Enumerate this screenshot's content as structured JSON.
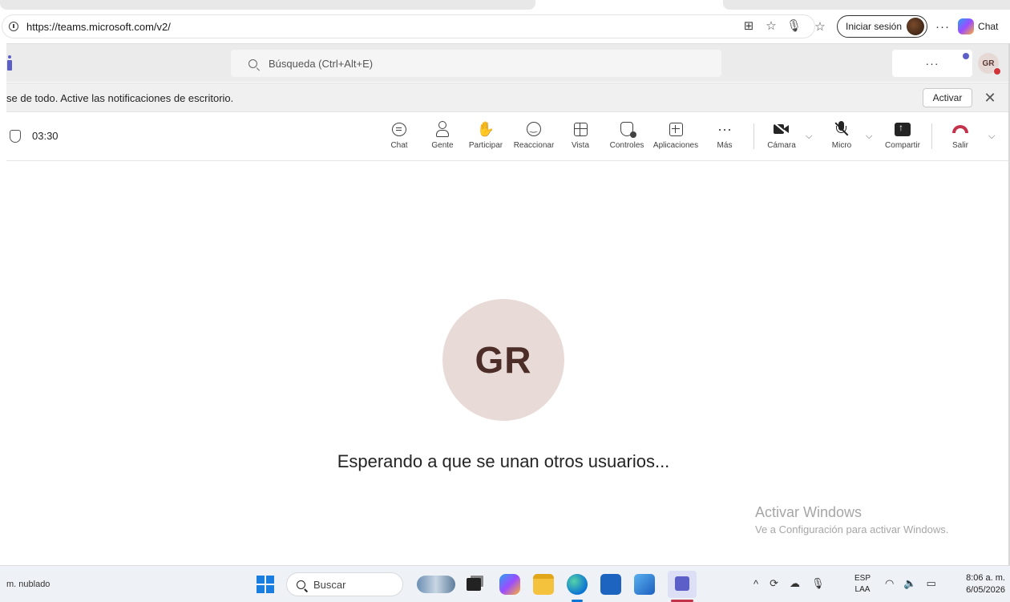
{
  "browser": {
    "url": "https://teams.microsoft.com/v2/",
    "signin_label": "Iniciar sesión",
    "more_label": "···",
    "copilot_label": "Chat"
  },
  "teams_header": {
    "search_placeholder": "Búsqueda (Ctrl+Alt+E)",
    "more_label": "···",
    "avatar_initials": "GR"
  },
  "banner": {
    "text": "se de todo. Active las notificaciones de escritorio.",
    "activate_label": "Activar",
    "close_label": "✕"
  },
  "meeting": {
    "timer": "03:30",
    "controls": [
      {
        "label": "Chat"
      },
      {
        "label": "Gente"
      },
      {
        "label": "Participar"
      },
      {
        "label": "Reaccionar"
      },
      {
        "label": "Vista"
      },
      {
        "label": "Controles"
      },
      {
        "label": "Aplicaciones"
      },
      {
        "label": "Más"
      },
      {
        "label": "Cámara"
      },
      {
        "label": "Micro"
      },
      {
        "label": "Compartir"
      },
      {
        "label": "Salir"
      }
    ],
    "more_glyph": "···",
    "hand_glyph": "✋",
    "chevron_glyph": "⌵"
  },
  "stage": {
    "avatar_initials": "GR",
    "waiting_text": "Esperando a que se unan otros usuarios...",
    "watermark_title": "Activar Windows",
    "watermark_subtitle": "Ve a Configuración para activar Windows."
  },
  "taskbar": {
    "weather_text": "m. nublado",
    "search_label": "Buscar",
    "tray_up": "^",
    "lang_line1": "ESP",
    "lang_line2": "LAA",
    "time": "8:06 a. m.",
    "date": "6/05/2026",
    "accent_colors": {
      "edge_bar": "#0c74d4",
      "teams_bar": "#c4314b"
    }
  },
  "colors": {
    "teams_purple": "#5b5fc7",
    "hangup_red": "#c4314b",
    "presence_busy": "#d13438",
    "avatar_bg": "#e8dad6"
  }
}
